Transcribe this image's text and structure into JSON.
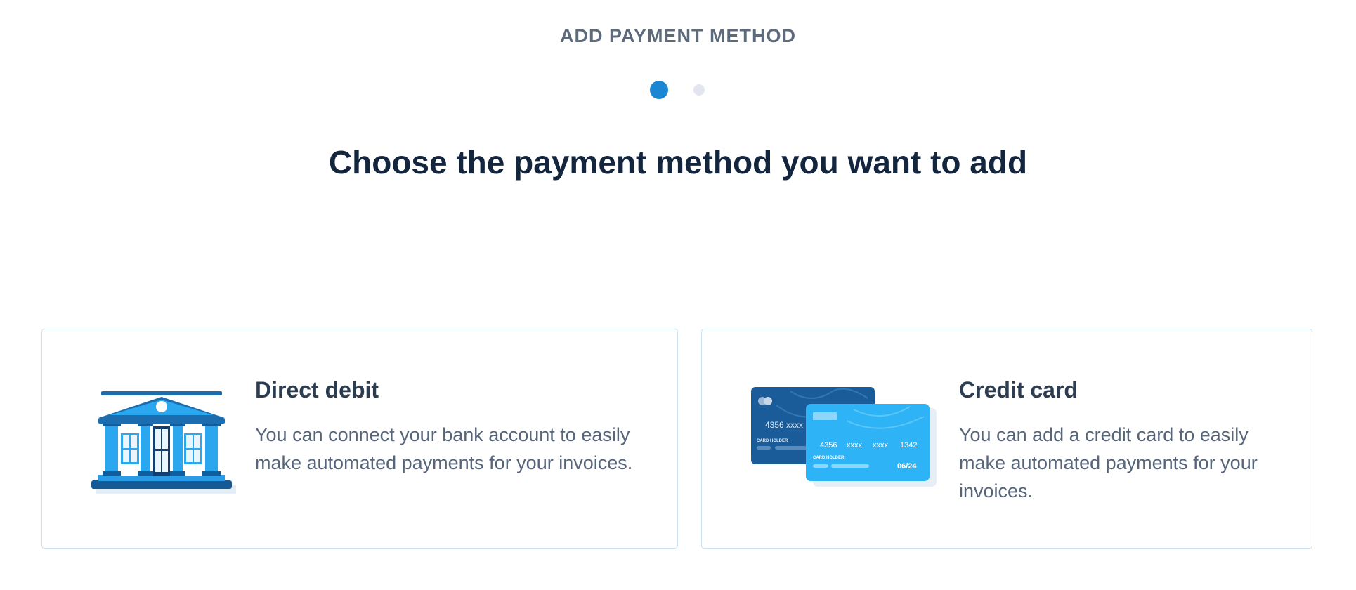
{
  "header": {
    "title": "ADD PAYMENT METHOD"
  },
  "stepper": {
    "current_step": 1,
    "total_steps": 2
  },
  "main": {
    "heading": "Choose the payment method you want to add",
    "options": [
      {
        "id": "direct-debit",
        "title": "Direct debit",
        "description": "You can connect your bank account to easily make automated payments for your invoices.",
        "icon": "bank-building-icon"
      },
      {
        "id": "credit-card",
        "title": "Credit card",
        "description": "You can add a credit card to easily make automated payments for your invoices.",
        "icon": "credit-cards-icon",
        "card_art": {
          "back_number": "4356   xxxx",
          "back_holder": "CARD HOLDER",
          "front_number": [
            "4356",
            "xxxx",
            "xxxx",
            "1342"
          ],
          "front_holder": "CARD HOLDER",
          "front_expiry": "06/24"
        }
      }
    ]
  },
  "colors": {
    "accent": "#1b86d2",
    "step_inactive": "#e3e6ee",
    "card_border": "#c9e3f3",
    "heading": "#14263d",
    "body_text": "#56657a"
  }
}
